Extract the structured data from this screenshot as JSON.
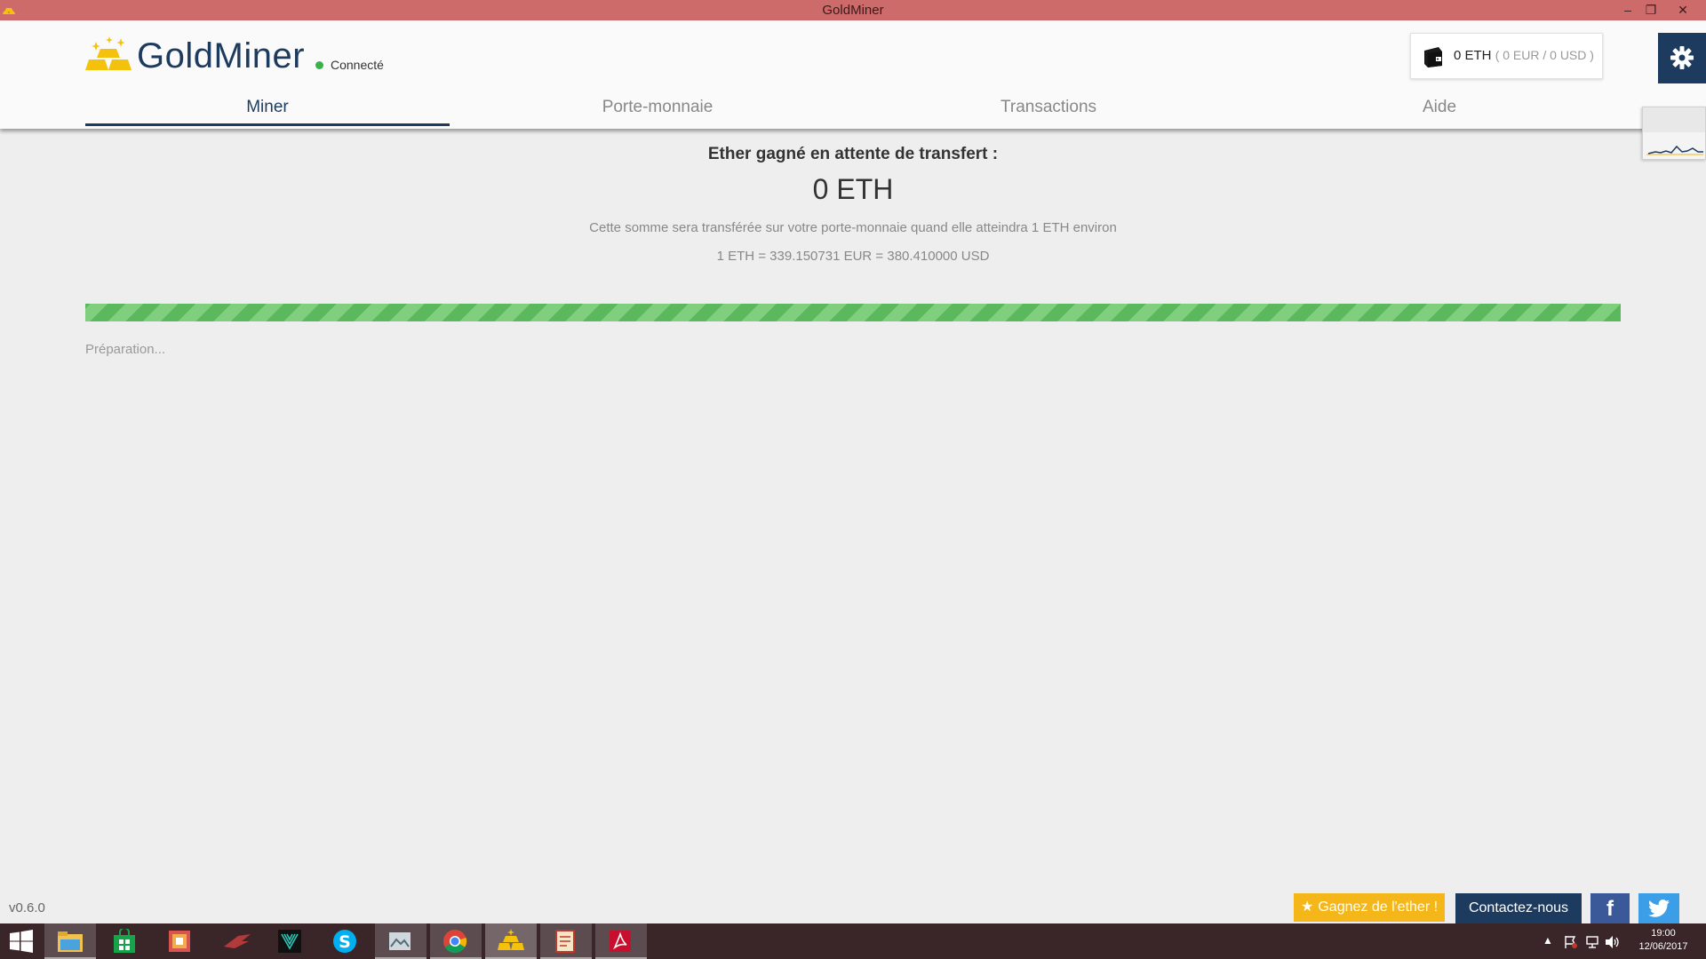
{
  "window": {
    "title": "GoldMiner",
    "minimize_glyph": "–",
    "maximize_glyph": "❐",
    "close_glyph": "✕"
  },
  "header": {
    "app_name": "GoldMiner",
    "connection_status": "Connecté",
    "wallet": {
      "eth": "0 ETH",
      "conversion": "( 0 EUR / 0 USD )"
    },
    "tabs": [
      {
        "label": "Miner",
        "active": true
      },
      {
        "label": "Porte-monnaie",
        "active": false
      },
      {
        "label": "Transactions",
        "active": false
      },
      {
        "label": "Aide",
        "active": false
      }
    ]
  },
  "main": {
    "earned_label": "Ether gagné en attente de transfert :",
    "earned_value": "0 ETH",
    "earned_note": "Cette somme sera transférée sur votre porte-monnaie quand elle atteindra 1 ETH environ",
    "rate": "1 ETH = 339.150731 EUR = 380.410000 USD",
    "progress_status": "Préparation...",
    "progress_fraction": 1.0
  },
  "footer": {
    "version": "v0.6.0",
    "earn_label": "Gagnez de l'ether !",
    "contact_label": "Contactez-nous",
    "facebook_glyph": "f"
  },
  "taskbar": {
    "clock_time": "19:00",
    "clock_date": "12/06/2017",
    "tray_arrow": "▲",
    "apps": [
      "start",
      "file-explorer",
      "store",
      "office",
      "rog",
      "steelseries",
      "skype",
      "photos",
      "chrome",
      "goldminer",
      "notes",
      "acrobat"
    ]
  },
  "colors": {
    "titlebar": "#cd6b6b",
    "brand_navy": "#1d3b5f",
    "gold": "#f4b619",
    "progress_green": "#5cb85c",
    "connected_green": "#3cb04a",
    "facebook": "#3b5998",
    "twitter": "#3b9ee6",
    "taskbar": "#3a2529"
  }
}
